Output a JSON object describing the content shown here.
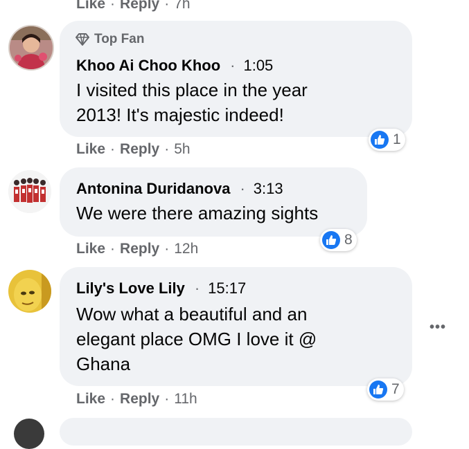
{
  "prev_actions": {
    "like": "Like",
    "reply": "Reply",
    "time": "7h"
  },
  "comments": [
    {
      "badge": "Top Fan",
      "name": "Khoo Ai Choo Khoo",
      "stamp": "1:05",
      "text": "I visited this place in the year\n2013! It's majestic indeed!",
      "reactions": "1",
      "like": "Like",
      "reply": "Reply",
      "time": "5h"
    },
    {
      "name": "Antonina Duridanova",
      "stamp": "3:13",
      "text": "We were there amazing sights",
      "reactions": "8",
      "like": "Like",
      "reply": "Reply",
      "time": "12h"
    },
    {
      "name": "Lily's Love Lily",
      "stamp": "15:17",
      "text": "Wow what a beautiful and an\nelegant place OMG I love it @\nGhana",
      "reactions": "7",
      "like": "Like",
      "reply": "Reply",
      "time": "11h"
    }
  ],
  "more_options": "•••",
  "separator_dot": "·",
  "colors": {
    "like_blue": "#1877f2",
    "bubble": "#f0f2f5",
    "meta_gray": "#65676b"
  }
}
